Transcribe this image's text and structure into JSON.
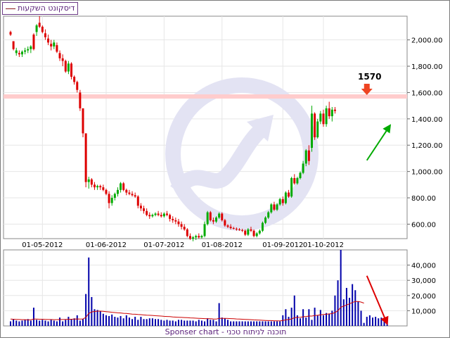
{
  "legend": {
    "series_name": "דיסקונט השקעות",
    "line_color": "#8b1a1a"
  },
  "footer": {
    "text": "Sponser chart - תוכנה לניתוח טכני"
  },
  "colors": {
    "up": "#00aa00",
    "down": "#dd0000",
    "volume": "#0000aa",
    "volume_ma": "#cc0000",
    "resistance": "#ffcccc",
    "grid": "#e6e6e6",
    "watermark": "#e3e3f3"
  },
  "chart_data": [
    {
      "type": "candlestick",
      "title": "",
      "x_tick_labels": [
        "01-05-2012",
        "01-06-2012",
        "01-07-2012",
        "01-08-2012",
        "01-09-2012",
        "01-10-2012"
      ],
      "x_tick_indices": [
        11,
        33,
        53,
        73,
        94,
        108
      ],
      "y_tick_labels": [
        "600.00",
        "800.00",
        "1,000.00",
        "1,200.00",
        "1,400.00",
        "1,600.00",
        "1,800.00",
        "2,000.00"
      ],
      "ylim": [
        490,
        2180
      ],
      "grid": true,
      "annotations": {
        "resistance_level": 1570,
        "resistance_label": "1570",
        "down_arrow_at_index": 123,
        "trend_arrow": {
          "from_index": 123,
          "from_value": 1085,
          "to_index": 131,
          "to_value": 1350
        }
      },
      "candles": [
        [
          2060,
          2070,
          2030,
          2040
        ],
        [
          1990,
          1990,
          1920,
          1930
        ],
        [
          1900,
          1940,
          1880,
          1920
        ],
        [
          1900,
          1920,
          1870,
          1890
        ],
        [
          1890,
          1920,
          1870,
          1910
        ],
        [
          1910,
          1940,
          1890,
          1920
        ],
        [
          1920,
          1950,
          1900,
          1930
        ],
        [
          1930,
          1960,
          1900,
          1950
        ],
        [
          2040,
          2050,
          1920,
          1930
        ],
        [
          2060,
          2120,
          2030,
          2110
        ],
        [
          2130,
          2180,
          2090,
          2100
        ],
        [
          2100,
          2110,
          2050,
          2060
        ],
        [
          2050,
          2080,
          2000,
          2020
        ],
        [
          2010,
          2040,
          1960,
          1980
        ],
        [
          1970,
          2000,
          1920,
          1950
        ],
        [
          1950,
          2000,
          1930,
          1980
        ],
        [
          1960,
          1980,
          1900,
          1910
        ],
        [
          1900,
          1920,
          1840,
          1860
        ],
        [
          1860,
          1890,
          1800,
          1840
        ],
        [
          1840,
          1850,
          1750,
          1760
        ],
        [
          1760,
          1840,
          1740,
          1820
        ],
        [
          1820,
          1830,
          1700,
          1720
        ],
        [
          1720,
          1730,
          1660,
          1680
        ],
        [
          1680,
          1690,
          1600,
          1620
        ],
        [
          1600,
          1620,
          1460,
          1480
        ],
        [
          1480,
          1480,
          1260,
          1290
        ],
        [
          1290,
          1290,
          880,
          920
        ],
        [
          920,
          960,
          870,
          940
        ],
        [
          940,
          950,
          880,
          900
        ],
        [
          900,
          920,
          860,
          880
        ],
        [
          880,
          900,
          860,
          890
        ],
        [
          890,
          900,
          860,
          880
        ],
        [
          880,
          900,
          850,
          860
        ],
        [
          860,
          870,
          820,
          830
        ],
        [
          830,
          850,
          720,
          760
        ],
        [
          760,
          820,
          740,
          800
        ],
        [
          800,
          840,
          780,
          830
        ],
        [
          830,
          880,
          810,
          860
        ],
        [
          860,
          920,
          840,
          910
        ],
        [
          910,
          920,
          850,
          860
        ],
        [
          860,
          870,
          820,
          840
        ],
        [
          840,
          860,
          820,
          830
        ],
        [
          830,
          850,
          810,
          820
        ],
        [
          820,
          840,
          800,
          810
        ],
        [
          810,
          820,
          720,
          740
        ],
        [
          740,
          760,
          700,
          720
        ],
        [
          720,
          740,
          680,
          700
        ],
        [
          700,
          720,
          660,
          670
        ],
        [
          670,
          690,
          640,
          660
        ],
        [
          660,
          680,
          650,
          670
        ],
        [
          670,
          690,
          660,
          680
        ],
        [
          680,
          700,
          660,
          670
        ],
        [
          670,
          690,
          650,
          660
        ],
        [
          660,
          690,
          650,
          680
        ],
        [
          680,
          700,
          660,
          670
        ],
        [
          670,
          680,
          620,
          640
        ],
        [
          640,
          660,
          610,
          630
        ],
        [
          630,
          650,
          600,
          620
        ],
        [
          620,
          640,
          580,
          600
        ],
        [
          600,
          620,
          560,
          580
        ],
        [
          580,
          600,
          550,
          560
        ],
        [
          560,
          570,
          500,
          510
        ],
        [
          510,
          530,
          480,
          490
        ],
        [
          490,
          510,
          470,
          500
        ],
        [
          500,
          520,
          480,
          510
        ],
        [
          510,
          530,
          490,
          500
        ],
        [
          500,
          520,
          490,
          510
        ],
        [
          510,
          620,
          500,
          600
        ],
        [
          600,
          700,
          590,
          690
        ],
        [
          690,
          700,
          620,
          630
        ],
        [
          630,
          650,
          600,
          620
        ],
        [
          620,
          660,
          610,
          650
        ],
        [
          650,
          690,
          640,
          680
        ],
        [
          680,
          690,
          620,
          630
        ],
        [
          630,
          640,
          580,
          590
        ],
        [
          590,
          600,
          570,
          580
        ],
        [
          580,
          600,
          560,
          570
        ],
        [
          570,
          580,
          560,
          565
        ],
        [
          565,
          575,
          550,
          560
        ],
        [
          560,
          570,
          550,
          555
        ],
        [
          555,
          565,
          540,
          550
        ],
        [
          550,
          560,
          510,
          520
        ],
        [
          520,
          570,
          510,
          560
        ],
        [
          560,
          580,
          540,
          550
        ],
        [
          550,
          560,
          500,
          510
        ],
        [
          510,
          540,
          500,
          530
        ],
        [
          530,
          560,
          520,
          550
        ],
        [
          550,
          620,
          540,
          610
        ],
        [
          610,
          660,
          600,
          650
        ],
        [
          650,
          700,
          640,
          690
        ],
        [
          690,
          760,
          680,
          750
        ],
        [
          750,
          770,
          700,
          710
        ],
        [
          710,
          760,
          700,
          750
        ],
        [
          750,
          800,
          740,
          790
        ],
        [
          790,
          810,
          740,
          760
        ],
        [
          760,
          850,
          750,
          840
        ],
        [
          840,
          860,
          800,
          810
        ],
        [
          810,
          960,
          800,
          950
        ],
        [
          950,
          980,
          900,
          910
        ],
        [
          910,
          960,
          900,
          950
        ],
        [
          950,
          1000,
          940,
          990
        ],
        [
          990,
          1080,
          980,
          1060
        ],
        [
          1060,
          1170,
          1040,
          1160
        ],
        [
          1160,
          1200,
          1050,
          1080
        ],
        [
          1180,
          1500,
          1150,
          1440
        ],
        [
          1440,
          1450,
          1240,
          1260
        ],
        [
          1260,
          1400,
          1250,
          1380
        ],
        [
          1380,
          1460,
          1360,
          1440
        ],
        [
          1440,
          1470,
          1340,
          1360
        ],
        [
          1360,
          1500,
          1340,
          1480
        ],
        [
          1480,
          1530,
          1400,
          1420
        ],
        [
          1420,
          1490,
          1380,
          1470
        ],
        [
          1470,
          1490,
          1440,
          1460
        ]
      ]
    },
    {
      "type": "bar",
      "title": "",
      "y_tick_labels": [
        "10,000",
        "20,000",
        "30,000",
        "40,000"
      ],
      "ylim": [
        0,
        50000
      ],
      "series": [
        {
          "name": "",
          "kind": "bar",
          "values": [
            3000,
            4500,
            3500,
            3000,
            3500,
            4000,
            4500,
            3500,
            12000,
            4000,
            3500,
            4000,
            3500,
            3000,
            4000,
            3500,
            3000,
            5500,
            3000,
            4000,
            6000,
            4500,
            5000,
            7000,
            3500,
            4500,
            21000,
            45000,
            19000,
            11000,
            10500,
            9500,
            8000,
            7000,
            6500,
            7500,
            6000,
            5500,
            6500,
            5000,
            7000,
            5500,
            4500,
            6000,
            4000,
            6000,
            4500,
            4500,
            5000,
            5000,
            4500,
            4500,
            4000,
            3500,
            4000,
            3500,
            3500,
            3000,
            4000,
            4000,
            3500,
            3500,
            3500,
            3500,
            3000,
            4000,
            3500,
            3000,
            5000,
            4000,
            4000,
            3000,
            15000,
            5500,
            5000,
            4000,
            3000,
            3000,
            3000,
            3000,
            3000,
            3000,
            3000,
            3000,
            3000,
            3000,
            3000,
            3000,
            3000,
            3000,
            3000,
            3000,
            3000,
            3000,
            7000,
            11000,
            6000,
            12000,
            20000,
            7000,
            5000,
            11000,
            5500,
            11000,
            4000,
            12000,
            7000,
            10500,
            7000,
            8500,
            8000,
            10000,
            20000,
            30000,
            51000,
            17500,
            25000,
            18500,
            27500,
            23500,
            16000,
            10000,
            2000,
            6000,
            7000,
            5500,
            6000,
            5000,
            5500,
            5000,
            5000
          ]
        },
        {
          "name": "",
          "kind": "line",
          "values": [
            4500,
            4400,
            4300,
            4200,
            4100,
            4100,
            4000,
            4000,
            4500,
            4500,
            4400,
            4400,
            4300,
            4200,
            4200,
            4100,
            4100,
            4200,
            4200,
            4300,
            4400,
            4400,
            4500,
            4600,
            4500,
            4600,
            5600,
            8200,
            9200,
            9500,
            9700,
            9700,
            9600,
            9400,
            9200,
            9000,
            8800,
            8600,
            8500,
            8300,
            8200,
            8000,
            7800,
            7700,
            7500,
            7400,
            7200,
            7100,
            7000,
            6900,
            6700,
            6600,
            6500,
            6300,
            6200,
            6100,
            5900,
            5800,
            5700,
            5600,
            5500,
            5400,
            5300,
            5200,
            5100,
            5000,
            4900,
            4800,
            4700,
            4700,
            4600,
            4500,
            5000,
            5000,
            5000,
            4900,
            4800,
            4700,
            4600,
            4500,
            4400,
            4300,
            4200,
            4100,
            4000,
            3900,
            3800,
            3700,
            3600,
            3500,
            3500,
            3400,
            3400,
            3300,
            3600,
            4000,
            4200,
            4600,
            5400,
            5600,
            5700,
            6000,
            6200,
            6500,
            6500,
            6800,
            7000,
            7300,
            7500,
            7700,
            7900,
            8100,
            8800,
            10000,
            12300,
            13000,
            13800,
            14500,
            15400,
            16100,
            16100,
            15700,
            15000
          ]
        }
      ],
      "annotations": {
        "down_arrow": {
          "from_index": 123,
          "from_value": 33000,
          "to_index": 130,
          "to_value": 1500
        }
      }
    }
  ]
}
